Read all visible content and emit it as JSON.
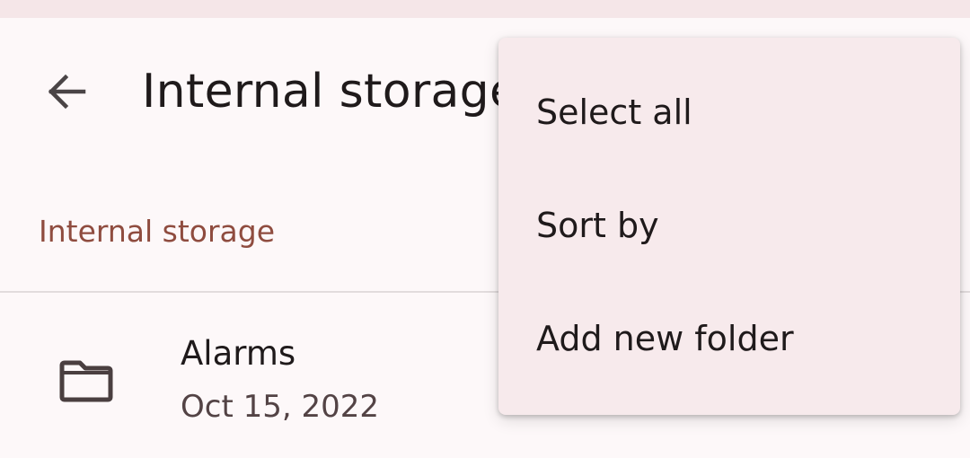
{
  "header": {
    "title": "Internal storage",
    "back_icon": "arrow-back-icon"
  },
  "breadcrumb": {
    "label": "Internal storage"
  },
  "files": [
    {
      "name": "Alarms",
      "date": "Oct 15, 2022",
      "icon": "folder-icon"
    }
  ],
  "menu": {
    "items": [
      {
        "label": "Select all"
      },
      {
        "label": "Sort by"
      },
      {
        "label": "Add new folder"
      }
    ]
  },
  "colors": {
    "background": "#fdf8f9",
    "accent": "#8f4c3f",
    "menu_surface": "#f7eaec",
    "text_primary": "#1f1a1b",
    "text_secondary": "#534345"
  }
}
